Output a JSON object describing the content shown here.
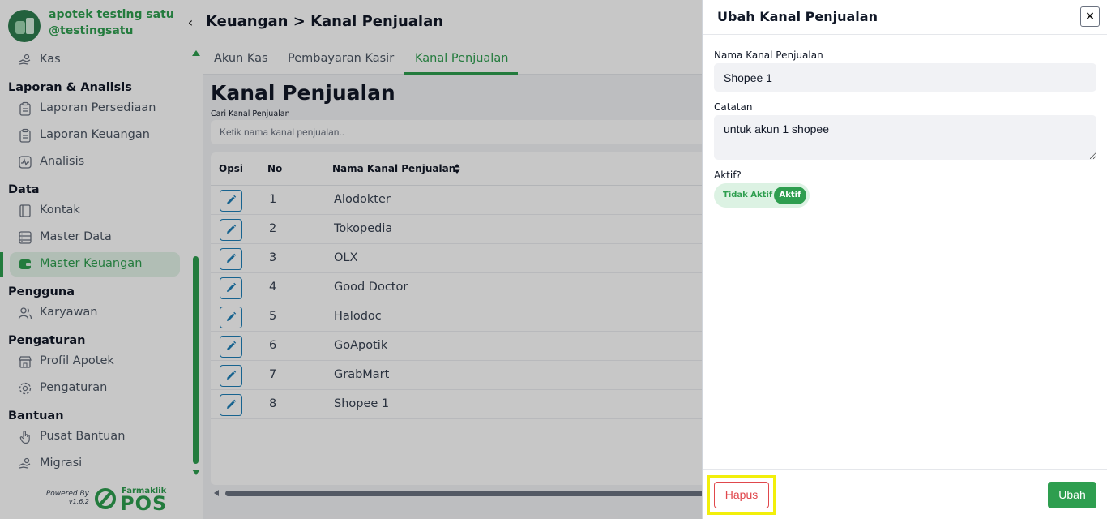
{
  "brand": {
    "name": "apotek testing satu",
    "handle": "@testingsatu"
  },
  "sidebar": {
    "items": {
      "kas": "Kas",
      "laporan_persediaan": "Laporan Persediaan",
      "laporan_keuangan": "Laporan Keuangan",
      "analisis": "Analisis",
      "kontak": "Kontak",
      "master_data": "Master Data",
      "master_keuangan": "Master Keuangan",
      "karyawan": "Karyawan",
      "profil_apotek": "Profil Apotek",
      "pengaturan": "Pengaturan",
      "pusat_bantuan": "Pusat Bantuan",
      "migrasi": "Migrasi"
    },
    "sections": {
      "laporan": "Laporan & Analisis",
      "data": "Data",
      "pengguna": "Pengguna",
      "pengaturan": "Pengaturan",
      "bantuan": "Bantuan"
    },
    "active_item": "Master Keuangan",
    "powered_by": "Powered By",
    "version": "v1.6.2",
    "logo_small": "Farmaklik",
    "logo_big": "POS"
  },
  "header": {
    "breadcrumb": "Keuangan > Kanal Penjualan"
  },
  "tabs": [
    "Akun Kas",
    "Pembayaran Kasir",
    "Kanal Penjualan"
  ],
  "active_tab": "Kanal Penjualan",
  "main": {
    "title": "Kanal Penjualan",
    "search_label": "Cari Kanal Penjualan",
    "search_placeholder": "Ketik nama kanal penjualan.."
  },
  "table": {
    "columns": [
      "Opsi",
      "No",
      "Nama Kanal Penjualan"
    ],
    "rows": [
      {
        "no": "1",
        "name": "Alodokter"
      },
      {
        "no": "2",
        "name": "Tokopedia"
      },
      {
        "no": "3",
        "name": "OLX"
      },
      {
        "no": "4",
        "name": "Good Doctor"
      },
      {
        "no": "5",
        "name": "Halodoc"
      },
      {
        "no": "6",
        "name": "GoApotik"
      },
      {
        "no": "7",
        "name": "GrabMart"
      },
      {
        "no": "8",
        "name": "Shopee 1"
      }
    ]
  },
  "drawer": {
    "title": "Ubah Kanal Penjualan",
    "close": "×",
    "name_label": "Nama Kanal Penjualan",
    "name_value": "Shopee 1",
    "note_label": "Catatan",
    "note_value": "untuk akun 1 shopee",
    "active_label": "Aktif?",
    "toggle_off": "Tidak Aktif",
    "toggle_on": "Aktif",
    "active_value": true,
    "delete_label": "Hapus",
    "submit_label": "Ubah"
  },
  "colors": {
    "brand_green": "#2e9e4f",
    "danger": "#e0474c",
    "highlight": "#f2ef0b",
    "edit_blue": "#1e7fb8"
  }
}
